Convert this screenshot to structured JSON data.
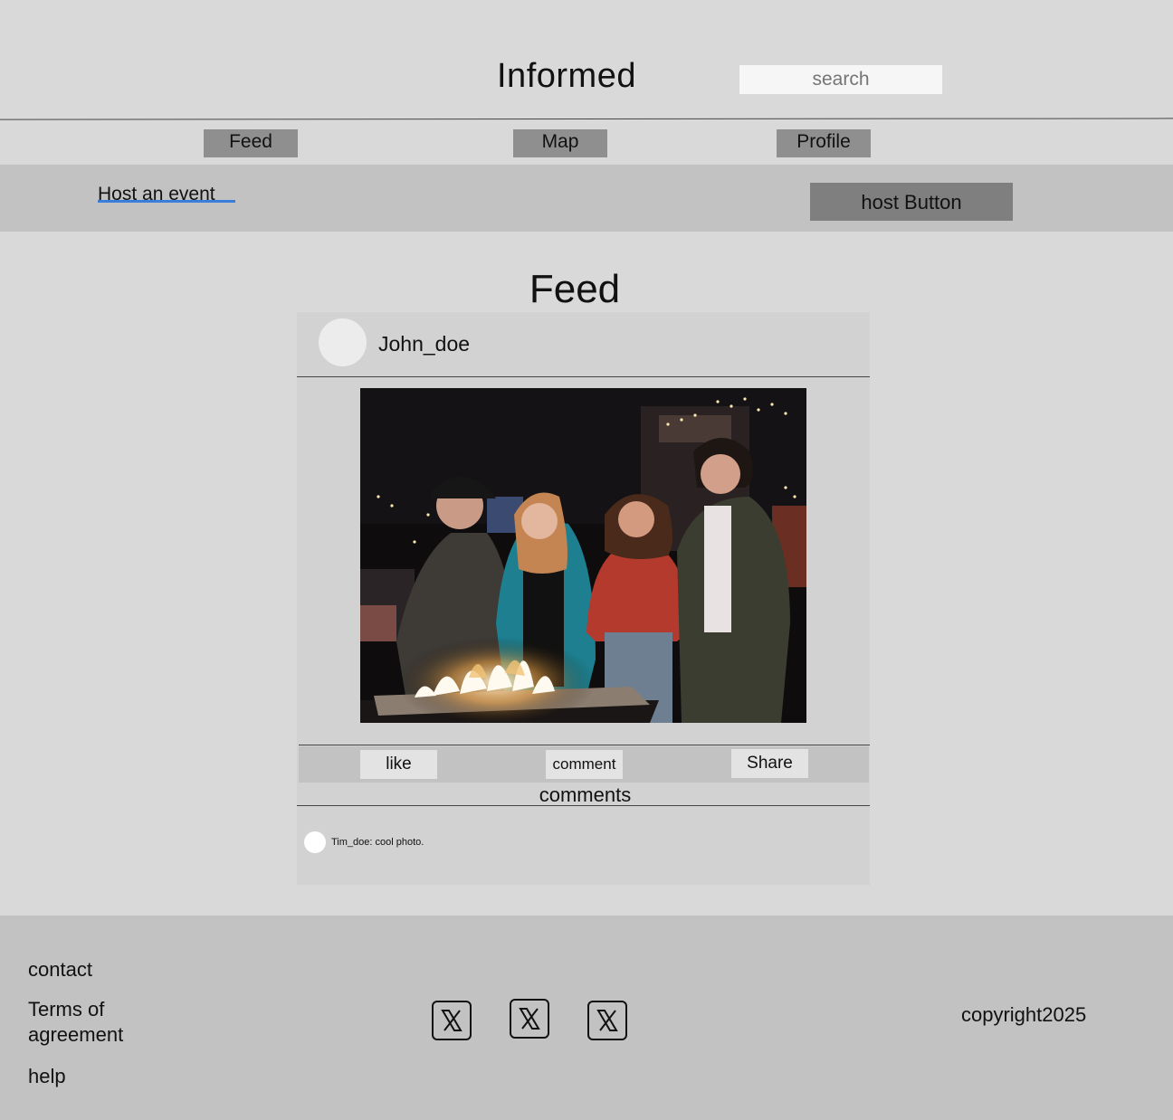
{
  "header": {
    "title": "Informed",
    "search_placeholder": "search"
  },
  "nav": {
    "feed": "Feed",
    "map": "Map",
    "profile": "Profile"
  },
  "host": {
    "link_label": "Host an event",
    "button_label": "host Button",
    "link_underline_color": "#3b7ddd"
  },
  "feed": {
    "heading": "Feed",
    "post": {
      "username": "John_doe",
      "actions": {
        "like": "like",
        "comment": "comment",
        "share": "Share"
      },
      "comments_title": "comments",
      "comments": [
        {
          "text": "Tim_doe: cool photo."
        }
      ]
    }
  },
  "footer": {
    "links": [
      "contact",
      "Terms of agreement",
      "help"
    ],
    "social_icons": [
      "x-icon",
      "x-icon",
      "x-icon"
    ],
    "copyright": "copyright2025"
  }
}
